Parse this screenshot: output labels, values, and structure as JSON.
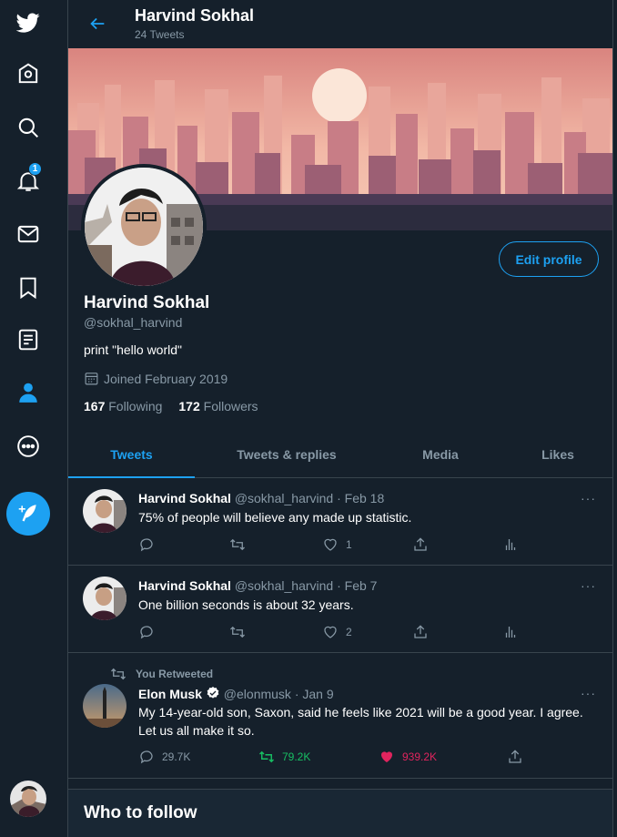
{
  "colors": {
    "accent": "#1da1f2",
    "background": "#15202b",
    "muted": "#8899a6",
    "like": "#e0245e",
    "retweet": "#17bf63"
  },
  "nav": {
    "items": [
      {
        "icon": "twitter-logo-icon"
      },
      {
        "icon": "home-icon"
      },
      {
        "icon": "explore-search-icon"
      },
      {
        "icon": "notifications-bell-icon",
        "badge": "1"
      },
      {
        "icon": "messages-envelope-icon"
      },
      {
        "icon": "bookmark-icon"
      },
      {
        "icon": "lists-icon"
      },
      {
        "icon": "profile-person-icon"
      },
      {
        "icon": "more-circle-icon"
      },
      {
        "icon": "compose-tweet-icon"
      }
    ]
  },
  "header": {
    "title": "Harvind Sokhal",
    "subtitle": "24 Tweets"
  },
  "profile": {
    "name": "Harvind Sokhal",
    "handle": "@sokhal_harvind",
    "bio": "print \"hello world\"",
    "joined": "Joined February 2019",
    "following_count": "167",
    "following_label": "Following",
    "followers_count": "172",
    "followers_label": "Followers",
    "edit_label": "Edit profile"
  },
  "tabs": [
    "Tweets",
    "Tweets & replies",
    "Media",
    "Likes"
  ],
  "tweets": [
    {
      "name": "Harvind Sokhal",
      "meta": "@sokhal_harvind · Feb 18",
      "text": "75% of people will believe any made up statistic.",
      "replies": "",
      "retweets": "",
      "likes": "1"
    },
    {
      "name": "Harvind Sokhal",
      "meta": "@sokhal_harvind · Feb 7",
      "text": "One billion seconds is about 32 years.",
      "replies": "",
      "retweets": "",
      "likes": "2"
    },
    {
      "retweeted_label": "You Retweeted",
      "name": "Elon Musk",
      "meta": "@elonmusk · Jan 9",
      "text": "My 14-year-old son, Saxon, said he feels like 2021 will be a good year. I agree. Let us all make it so.",
      "replies": "29.7K",
      "retweets": "79.2K",
      "likes": "939.2K"
    }
  ],
  "who_to_follow": {
    "title": "Who to follow"
  },
  "more_glyph": "···"
}
